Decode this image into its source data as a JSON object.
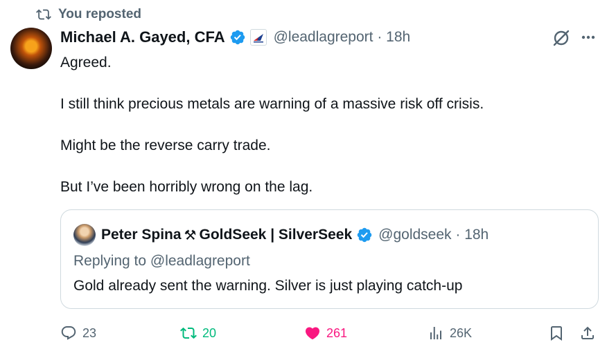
{
  "repost": {
    "label": "You reposted",
    "icon": "repost-icon"
  },
  "tweet": {
    "author_name": "Michael A. Gayed, CFA",
    "handle_time": "@leadlagreport · 18h",
    "paragraphs": [
      "Agreed.",
      "I still think precious metals are warning of a massive risk off crisis.",
      "Might be the reverse carry trade.",
      "But I’ve been horribly wrong on the lag."
    ]
  },
  "quote": {
    "author_name": "Peter Spina",
    "emoji": "⚒",
    "brand": "GoldSeek | SilverSeek",
    "handle_time": "@goldseek · 18h",
    "replying": "Replying to @leadlagreport",
    "text": "Gold already sent the warning. Silver is just playing catch-up"
  },
  "actions": {
    "replies": "23",
    "reposts": "20",
    "likes": "261",
    "views": "26K"
  },
  "colors": {
    "verified": "#1d9bf0",
    "repost_active": "#00ba7c",
    "like_active": "#f91880",
    "muted": "#536471"
  }
}
